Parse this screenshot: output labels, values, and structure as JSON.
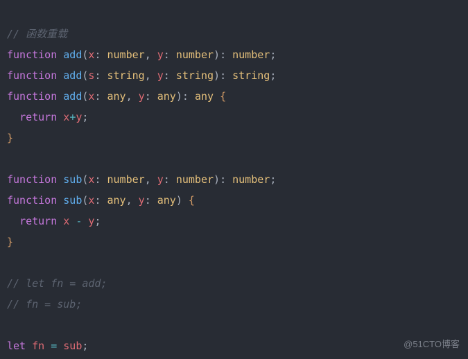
{
  "code": {
    "l1_comment": "// 函数重载",
    "l2": {
      "kw": "function",
      "fn": "add",
      "p1": "x",
      "t1": "number",
      "p2": "y",
      "t2": "number",
      "ret": "number"
    },
    "l3": {
      "kw": "function",
      "fn": "add",
      "p1": "s",
      "t1": "string",
      "p2": "y",
      "t2": "string",
      "ret": "string"
    },
    "l4": {
      "kw": "function",
      "fn": "add",
      "p1": "x",
      "t1": "any",
      "p2": "y",
      "t2": "any",
      "ret": "any"
    },
    "l5": {
      "kw": "return",
      "a": "x",
      "op": "+",
      "b": "y"
    },
    "l7": {
      "kw": "function",
      "fn": "sub",
      "p1": "x",
      "t1": "number",
      "p2": "y",
      "t2": "number",
      "ret": "number"
    },
    "l8": {
      "kw": "function",
      "fn": "sub",
      "p1": "x",
      "t1": "any",
      "p2": "y",
      "t2": "any"
    },
    "l9": {
      "kw": "return",
      "a": "x",
      "op": "-",
      "b": "y"
    },
    "l11_comment": "// let fn = add;",
    "l12_comment": "// fn = sub;",
    "l13": {
      "kw": "let",
      "name": "fn",
      "val": "sub"
    },
    "brace_open": "{",
    "brace_close": "}",
    "semi": ";",
    "colon": ":",
    "comma": ",",
    "paren_open": "(",
    "paren_close": ")",
    "eq": "="
  },
  "watermark": "@51CTO博客"
}
